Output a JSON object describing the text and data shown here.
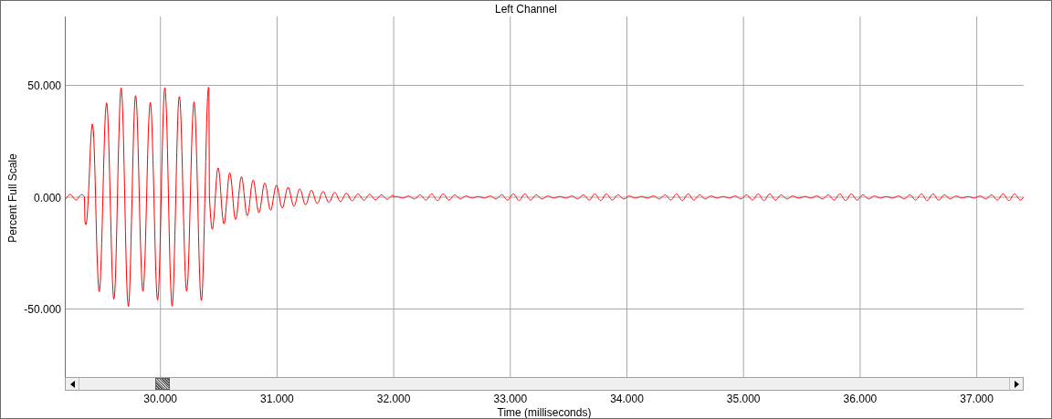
{
  "title": "Left Channel",
  "y_axis": {
    "label": "Percent Full Scale",
    "ticks": [
      "50.000",
      "0.000",
      "-50.000"
    ]
  },
  "x_axis": {
    "label": "Time (milliseconds)",
    "ticks": [
      "30.000",
      "31.000",
      "32.000",
      "33.000",
      "34.000",
      "35.000",
      "36.000",
      "37.000"
    ]
  }
}
